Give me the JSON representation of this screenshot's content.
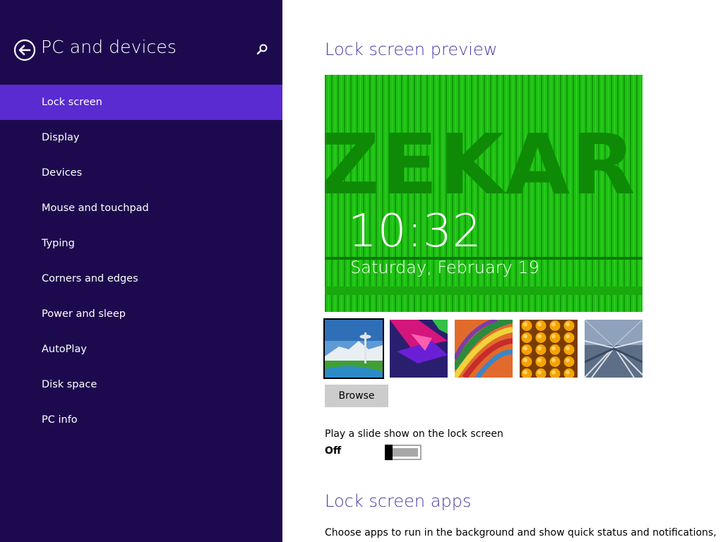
{
  "header": {
    "title": "PC and devices",
    "back_icon": "back-arrow-icon",
    "search_icon": "search-icon"
  },
  "sidebar": {
    "items": [
      {
        "label": "Lock screen",
        "selected": true
      },
      {
        "label": "Display"
      },
      {
        "label": "Devices"
      },
      {
        "label": "Mouse and touchpad"
      },
      {
        "label": "Typing"
      },
      {
        "label": "Corners and edges"
      },
      {
        "label": "Power and sleep"
      },
      {
        "label": "AutoPlay"
      },
      {
        "label": "Disk space"
      },
      {
        "label": "PC info"
      }
    ]
  },
  "main": {
    "preview_title": "Lock screen preview",
    "preview": {
      "banner_text": "ZEKAR",
      "time": "10:32",
      "date": "Saturday, February 19"
    },
    "thumbnails": [
      {
        "name": "space-needle-thumbnail",
        "selected": true
      },
      {
        "name": "geometric-shapes-thumbnail"
      },
      {
        "name": "colored-ribbons-thumbnail"
      },
      {
        "name": "honeycomb-thumbnail"
      },
      {
        "name": "train-tracks-thumbnail"
      }
    ],
    "browse_label": "Browse",
    "slideshow_label": "Play a slide show on the lock screen",
    "slideshow_state": "Off",
    "apps_title": "Lock screen apps",
    "apps_description": "Choose apps to run in the background and show quick status and notifications,"
  },
  "colors": {
    "sidebar_bg": "#1d0a4e",
    "selected_item": "#5a2bd1",
    "accent_text": "#4b3aa4",
    "preview_green": "#1dbd11"
  }
}
